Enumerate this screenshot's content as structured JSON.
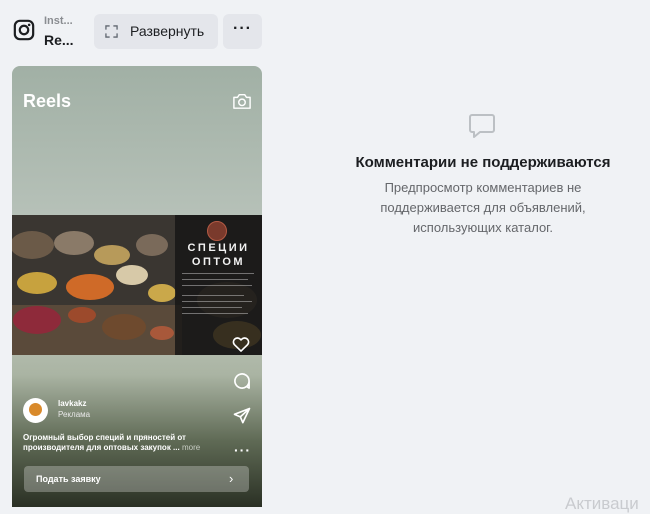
{
  "header": {
    "app_name": "Inst...",
    "placement": "Re...",
    "expand_label": "Развернуть",
    "more_label": "···"
  },
  "preview": {
    "reels_label": "Reels",
    "image_panel_title": "СПЕЦИИ ОПТОМ",
    "account": {
      "name": "lavkakz",
      "sponsored_label": "Реклама"
    },
    "caption": {
      "text": "Огромный выбор специй и пряностей от производителя для оптовых закупок ...",
      "more": "more"
    },
    "cta_label": "Подать заявку",
    "cta_chevron": "›",
    "more_dots": "···"
  },
  "comments": {
    "title": "Комментарии не поддерживаются",
    "description": "Предпросмотр комментариев не поддерживается для объявлений, использующих каталог."
  },
  "watermark": "Активаци",
  "icons": {
    "logo": "instagram-icon",
    "expand": "expand-icon",
    "camera": "camera-icon",
    "like": "heart-icon",
    "comment": "comment-icon",
    "share": "send-icon",
    "comments_empty": "speech-bubble-icon"
  }
}
